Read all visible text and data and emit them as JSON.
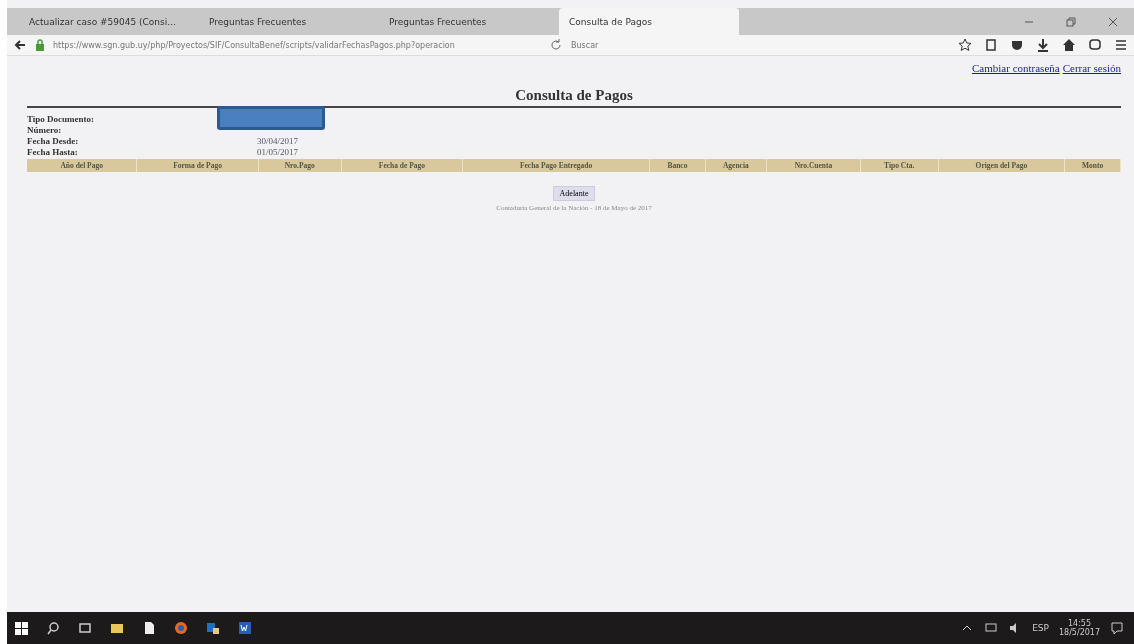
{
  "browser": {
    "tabs": [
      {
        "label": "Actualizar caso #59045 (Consi...",
        "selected": false
      },
      {
        "label": "Preguntas Frecuentes",
        "selected": false
      },
      {
        "label": "Preguntas Frecuentes",
        "selected": false
      },
      {
        "label": "Consulta de Pagos",
        "selected": true
      }
    ],
    "url": "https://www.sgn.gub.uy/php/Proyectos/SIF/ConsultaBenef/scripts/validarFechasPagos.php?operacion",
    "search": {
      "placeholder": "Buscar"
    }
  },
  "page": {
    "links": [
      "Cambiar contraseña",
      "Cerrar sesión"
    ],
    "title": "Consulta de Pagos",
    "fields": [
      {
        "label": "Tipo Documento:",
        "redacted": true
      },
      {
        "label": "Número:",
        "redacted": false
      },
      {
        "label": "Fecha Desde:",
        "value": "30/04/2017",
        "redacted": false
      },
      {
        "label": "Fecha Hasta:",
        "value": "01/05/2017",
        "redacted": false
      }
    ],
    "table": {
      "columns": [
        "Año del Pago",
        "Forma de Pago",
        "Nro.Pago",
        "Fecha de Pago",
        "Fecha Pago Entregado",
        "Banco",
        "Agencia",
        "Nro.Cuenta",
        "Tipo Cta.",
        "Origen del Pago",
        "Monto"
      ]
    },
    "button": "Adelante",
    "footer": "Contaduría General de la Nación - 18 de Mayo de 2017"
  },
  "taskbar": {
    "language": "ESP",
    "time": "14:55",
    "date": "18/5/2017"
  }
}
